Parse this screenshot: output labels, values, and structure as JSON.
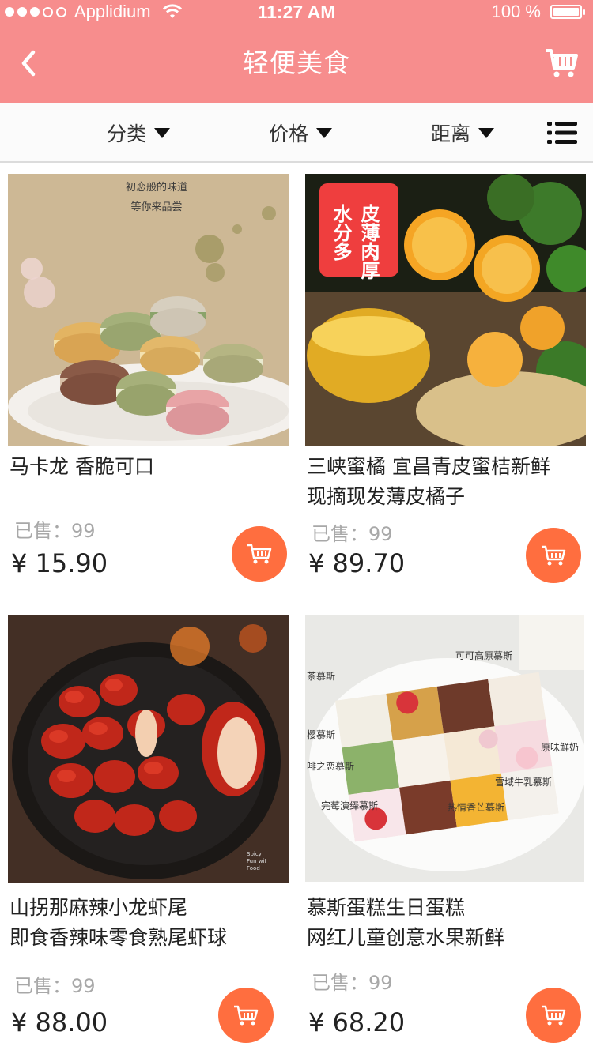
{
  "status_bar": {
    "carrier": "Applidium",
    "time": "11:27 AM",
    "battery": "100 %"
  },
  "nav": {
    "title": "轻便美食",
    "back_icon": "chevron-left-icon",
    "cart_icon": "shopping-cart-icon"
  },
  "filters": [
    {
      "label": "分类"
    },
    {
      "label": "价格"
    },
    {
      "label": "距离"
    }
  ],
  "products": [
    {
      "title_line1": "马卡龙 香脆可口",
      "title_line2": "",
      "sold": "已售：99",
      "price": "¥ 15.90",
      "image_text": [
        "初恋般的味道",
        "等你来品尝"
      ]
    },
    {
      "title_line1": "三峡蜜橘 宜昌青皮蜜桔新鲜",
      "title_line2": "现摘现发薄皮橘子",
      "sold": "已售：99",
      "price": "¥ 89.70",
      "image_text": [
        "水分多",
        "皮薄肉厚"
      ]
    },
    {
      "title_line1": "山拐那麻辣小龙虾尾",
      "title_line2": "即食香辣味零食熟尾虾球",
      "sold": "已售：99",
      "price": "¥ 88.00",
      "image_text": [
        "Spicy",
        "Fun wit",
        "Food"
      ]
    },
    {
      "title_line1": "慕斯蛋糕生日蛋糕",
      "title_line2": "网红儿童创意水果新鲜",
      "sold": "已售：99",
      "price": "¥ 68.20",
      "image_text": [
        "可可高原慕斯",
        "茶慕斯",
        "樱慕斯",
        "原味鲜奶",
        "啡之恋慕斯",
        "雪域牛乳慕斯",
        "完莓演绎慕斯",
        "热情香芒慕斯"
      ]
    }
  ],
  "colors": {
    "header": "#f78d8d",
    "accent": "#ff6e3f"
  }
}
